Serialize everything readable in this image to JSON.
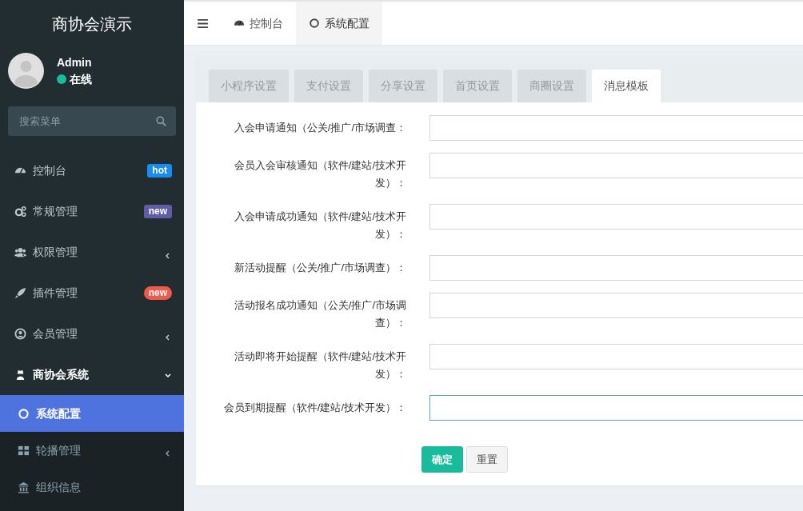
{
  "sidebar": {
    "logo": "商协会演示",
    "user": {
      "name": "Admin",
      "status": "在线"
    },
    "search": {
      "placeholder": "搜索菜单"
    },
    "items": [
      {
        "label": "控制台",
        "badge": {
          "text": "hot",
          "color": "#1a8cf0"
        }
      },
      {
        "label": "常规管理",
        "badge": {
          "text": "new",
          "color": "#605ca8"
        }
      },
      {
        "label": "权限管理",
        "expanded": false
      },
      {
        "label": "插件管理",
        "badge": {
          "text": "new",
          "color": "#f05a4a"
        }
      },
      {
        "label": "会员管理",
        "expanded": false
      },
      {
        "label": "商协会系统",
        "expanded": true,
        "children": [
          {
            "label": "系统配置",
            "selected": true
          },
          {
            "label": "轮播管理",
            "selected": false,
            "expanded": false
          },
          {
            "label": "组织信息",
            "selected": false
          }
        ]
      }
    ]
  },
  "header": {
    "tabs": [
      {
        "label": "控制台",
        "selected": false
      },
      {
        "label": "系统配置",
        "selected": true
      }
    ]
  },
  "config_tabs": [
    {
      "label": "小程序设置",
      "selected": false
    },
    {
      "label": "支付设置",
      "selected": false
    },
    {
      "label": "分享设置",
      "selected": false
    },
    {
      "label": "首页设置",
      "selected": false
    },
    {
      "label": "商圈设置",
      "selected": false
    },
    {
      "label": "消息模板",
      "selected": true
    }
  ],
  "fields": [
    {
      "label": "入会申请通知（公关/推广/市场调查：",
      "focused": false
    },
    {
      "label": "会员入会审核通知（软件/建站/技术开发）：",
      "focused": false
    },
    {
      "label": "入会申请成功通知（软件/建站/技术开发）：",
      "focused": false
    },
    {
      "label": "新活动提醒（公关/推广/市场调查）：",
      "focused": false
    },
    {
      "label": "活动报名成功通知（公关/推广/市场调查）：",
      "focused": false
    },
    {
      "label": "活动即将开始提醒（软件/建站/技术开发）：",
      "focused": false
    },
    {
      "label": "会员到期提醒（软件/建站/技术开发）：",
      "focused": true
    }
  ],
  "buttons": [
    {
      "label": "确定",
      "kind": "primary"
    },
    {
      "label": "重置",
      "kind": "secondary"
    }
  ]
}
